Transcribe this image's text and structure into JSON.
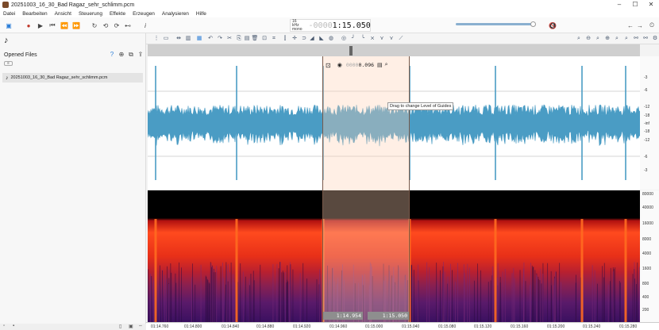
{
  "window": {
    "title": "20251003_16_30_Bad Ragaz_sehr_schlimm.pcm",
    "minimize": "–",
    "maximize": "☐",
    "close": "✕"
  },
  "menu": [
    "Datei",
    "Bearbeiten",
    "Ansicht",
    "Steuerung",
    "Effekte",
    "Erzeugen",
    "Analysieren",
    "Hilfe"
  ],
  "transport": {
    "format_rate": "16 kHz",
    "format_channels": "mono",
    "time_dim": "-0000",
    "time_value": "1:15.050"
  },
  "left_panel": {
    "title": "Opened Files",
    "files": [
      "20251003_16_30_Bad Ragaz_sehr_schlimm.pcm"
    ]
  },
  "selection": {
    "db_dim": "0000",
    "db_value": "0.096",
    "start": "1:14.954",
    "end": "1:15.050",
    "tooltip": "Drag to change Level of Guides"
  },
  "wave_ruler": [
    "-3",
    "-6",
    "-12",
    "-18",
    "-inf",
    "-18",
    "-12",
    "-6",
    "-3"
  ],
  "spec_ruler": [
    "80000",
    "40000",
    "16000",
    "8000",
    "4000",
    "1600",
    "800",
    "400",
    "200"
  ],
  "timeline": [
    "01:14.760",
    "01:14.800",
    "01:14.840",
    "01:14.880",
    "01:14.920",
    "01:14.960",
    "01:15.000",
    "01:15.040",
    "01:15.080",
    "01:15.120",
    "01:15.160",
    "01:15.200",
    "01:15.240",
    "01:15.280"
  ],
  "colors": {
    "waveform": "#4a9cc4",
    "selection": "#ffd2b4",
    "spectrogram_high": "#ff4422",
    "spectrogram_low": "#5a1a6a"
  }
}
